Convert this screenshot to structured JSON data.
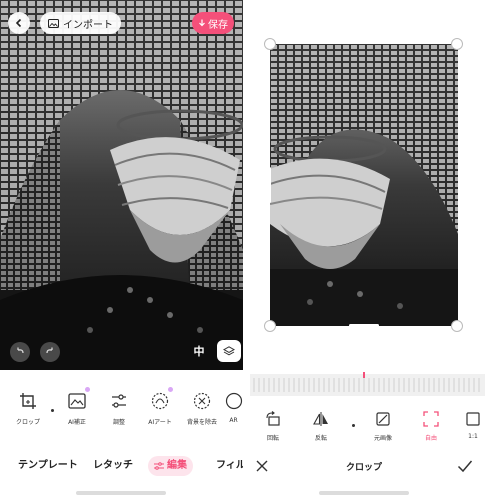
{
  "left": {
    "header": {
      "import_label": "インポート",
      "save_label": "保存"
    },
    "tools": [
      {
        "label": "クロップ",
        "icon": "crop-icon"
      },
      {
        "label": "AI補正",
        "icon": "ai-enhance-icon"
      },
      {
        "label": "調整",
        "icon": "adjust-sliders-icon"
      },
      {
        "label": "AIアート",
        "icon": "ai-art-icon"
      },
      {
        "label": "背景を除去",
        "icon": "remove-background-icon"
      },
      {
        "label": "AR",
        "icon": "ar-icon"
      }
    ],
    "tabs": [
      {
        "label": "テンプレート"
      },
      {
        "label": "レタッチ"
      },
      {
        "label": "編集",
        "active": true
      },
      {
        "label": "フィル"
      }
    ],
    "compare_label": "中"
  },
  "right": {
    "crop_tools": [
      {
        "label": "回転",
        "icon": "rotate-icon"
      },
      {
        "label": "反転",
        "icon": "flip-icon"
      },
      {
        "label": "元画像",
        "icon": "original-ratio-icon"
      },
      {
        "label": "自由",
        "icon": "free-crop-icon",
        "active": true
      },
      {
        "label": "1:1",
        "icon": "square-ratio-icon"
      }
    ],
    "title": "クロップ"
  },
  "colors": {
    "accent": "#f4507a",
    "accent_light": "#fde4ec"
  }
}
